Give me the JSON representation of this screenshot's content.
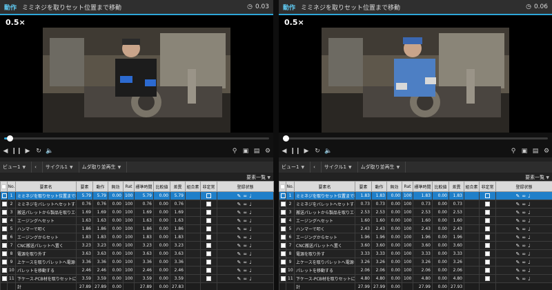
{
  "left": {
    "tab_label": "動作",
    "title": "ミミネジを取りセット位置まで移動",
    "time": "0.03",
    "speed": "0.5×",
    "progress": 0.02,
    "view_label": "ビュー1",
    "cycle_label": "サイクル1",
    "loop_label": "ムダ取り並再生",
    "list_label": "要素一覧",
    "headers": [
      "No.",
      "要素名",
      "要素",
      "動作",
      "無効",
      "Rat",
      "標準時間",
      "比較値",
      "差異",
      "組合素",
      "非定常",
      "登録状態"
    ],
    "rows": [
      [
        "1",
        "ミミネジを取りセット位置まで移動",
        "5.79",
        "5.79",
        "0.00",
        "100",
        "5.79",
        "0.00",
        "5.79"
      ],
      [
        "2",
        "ミミネジをバレットへセットする",
        "0.76",
        "0.76",
        "0.00",
        "100",
        "0.76",
        "0.00",
        "0.76"
      ],
      [
        "3",
        "搬送パレットから製品を取りエージングへ",
        "1.69",
        "1.69",
        "0.00",
        "100",
        "1.69",
        "0.00",
        "1.69"
      ],
      [
        "4",
        "エージングへセット",
        "1.63",
        "1.63",
        "0.00",
        "100",
        "1.63",
        "0.00",
        "1.63"
      ],
      [
        "5",
        "ハンマーで叩く",
        "1.86",
        "1.86",
        "0.00",
        "100",
        "1.86",
        "0.00",
        "1.86"
      ],
      [
        "6",
        "エージングからセット",
        "1.83",
        "1.83",
        "0.00",
        "100",
        "1.83",
        "0.00",
        "1.83"
      ],
      [
        "7",
        "CNC搬送パレットへ置く",
        "3.23",
        "3.23",
        "0.00",
        "100",
        "3.23",
        "0.00",
        "3.23"
      ],
      [
        "8",
        "電源を取り外す",
        "3.63",
        "3.63",
        "0.00",
        "100",
        "3.63",
        "0.00",
        "3.63"
      ],
      [
        "9",
        "上ケースを取りパレットへ電源･上ケース",
        "3.36",
        "3.36",
        "0.00",
        "100",
        "3.36",
        "0.00",
        "3.36"
      ],
      [
        "10",
        "パレットを移動する",
        "2.46",
        "2.46",
        "0.00",
        "100",
        "2.46",
        "0.00",
        "2.46"
      ],
      [
        "11",
        "下ケース-PCB材を取りセットにセットしボ",
        "3.59",
        "3.59",
        "0.00",
        "100",
        "3.59",
        "0.00",
        "3.59"
      ]
    ],
    "total": [
      "計",
      "27.89",
      "27.89",
      "0.00",
      "",
      "27.89",
      "0.00",
      "27.83"
    ]
  },
  "right": {
    "tab_label": "動作",
    "title": "ミミネジを取りセット位置まで移動",
    "time": "0.06",
    "speed": "0.5×",
    "progress": 0.01,
    "view_label": "ビュー1",
    "cycle_label": "サイクル1",
    "loop_label": "ムダ取り並再生",
    "list_label": "要素一覧",
    "headers": [
      "No.",
      "要素名",
      "要素",
      "動作",
      "無効",
      "Rat",
      "標準時間",
      "比較値",
      "差異",
      "組合素",
      "非定常",
      "登録状態"
    ],
    "rows": [
      [
        "1",
        "ミミネジを取りセット位置まで移動",
        "1.83",
        "1.83",
        "0.00",
        "100",
        "1.83",
        "0.00",
        "1.83"
      ],
      [
        "2",
        "ミミネジをバレットへセットする",
        "0.73",
        "0.73",
        "0.00",
        "100",
        "0.73",
        "0.00",
        "0.73"
      ],
      [
        "3",
        "搬送パレットから製品を取りエージングへ",
        "2.53",
        "2.53",
        "0.00",
        "100",
        "2.53",
        "0.00",
        "2.53"
      ],
      [
        "4",
        "エージングへセット",
        "1.60",
        "1.60",
        "0.00",
        "100",
        "1.60",
        "0.00",
        "1.60"
      ],
      [
        "5",
        "ハンマーで叩く",
        "2.43",
        "2.43",
        "0.00",
        "100",
        "2.43",
        "0.00",
        "2.43"
      ],
      [
        "6",
        "エージングからセット",
        "1.96",
        "1.96",
        "0.00",
        "100",
        "1.96",
        "0.00",
        "1.96"
      ],
      [
        "7",
        "CNC搬送パレットへ置く",
        "3.60",
        "3.60",
        "0.00",
        "100",
        "3.60",
        "0.00",
        "3.60"
      ],
      [
        "8",
        "電源を取り外す",
        "3.33",
        "3.33",
        "0.00",
        "100",
        "3.33",
        "0.00",
        "3.33"
      ],
      [
        "9",
        "上ケースを取りパレットへ電源･上ケース",
        "3.26",
        "3.26",
        "0.00",
        "100",
        "3.26",
        "0.00",
        "3.26"
      ],
      [
        "10",
        "パレットを移動する",
        "2.06",
        "2.06",
        "0.00",
        "100",
        "2.06",
        "0.00",
        "2.06"
      ],
      [
        "11",
        "下ケース-PCB材を取りセットにセットしボ",
        "4.80",
        "4.80",
        "0.00",
        "100",
        "4.80",
        "0.00",
        "4.80"
      ]
    ],
    "total": [
      "計",
      "27.99",
      "27.99",
      "0.00",
      "",
      "27.99",
      "0.00",
      "27.93"
    ]
  },
  "icons": {
    "clock": "clock-icon",
    "prev": "step-back-icon",
    "pause": "pause-icon",
    "play": "play-icon",
    "loop": "loop-icon",
    "volume": "volume-icon",
    "search": "search-icon",
    "image": "image-icon",
    "folder": "folder-icon",
    "settings": "gear-icon"
  },
  "colors": {
    "accent": "#2ea6d8",
    "selected_row": "#1f7fc9"
  }
}
